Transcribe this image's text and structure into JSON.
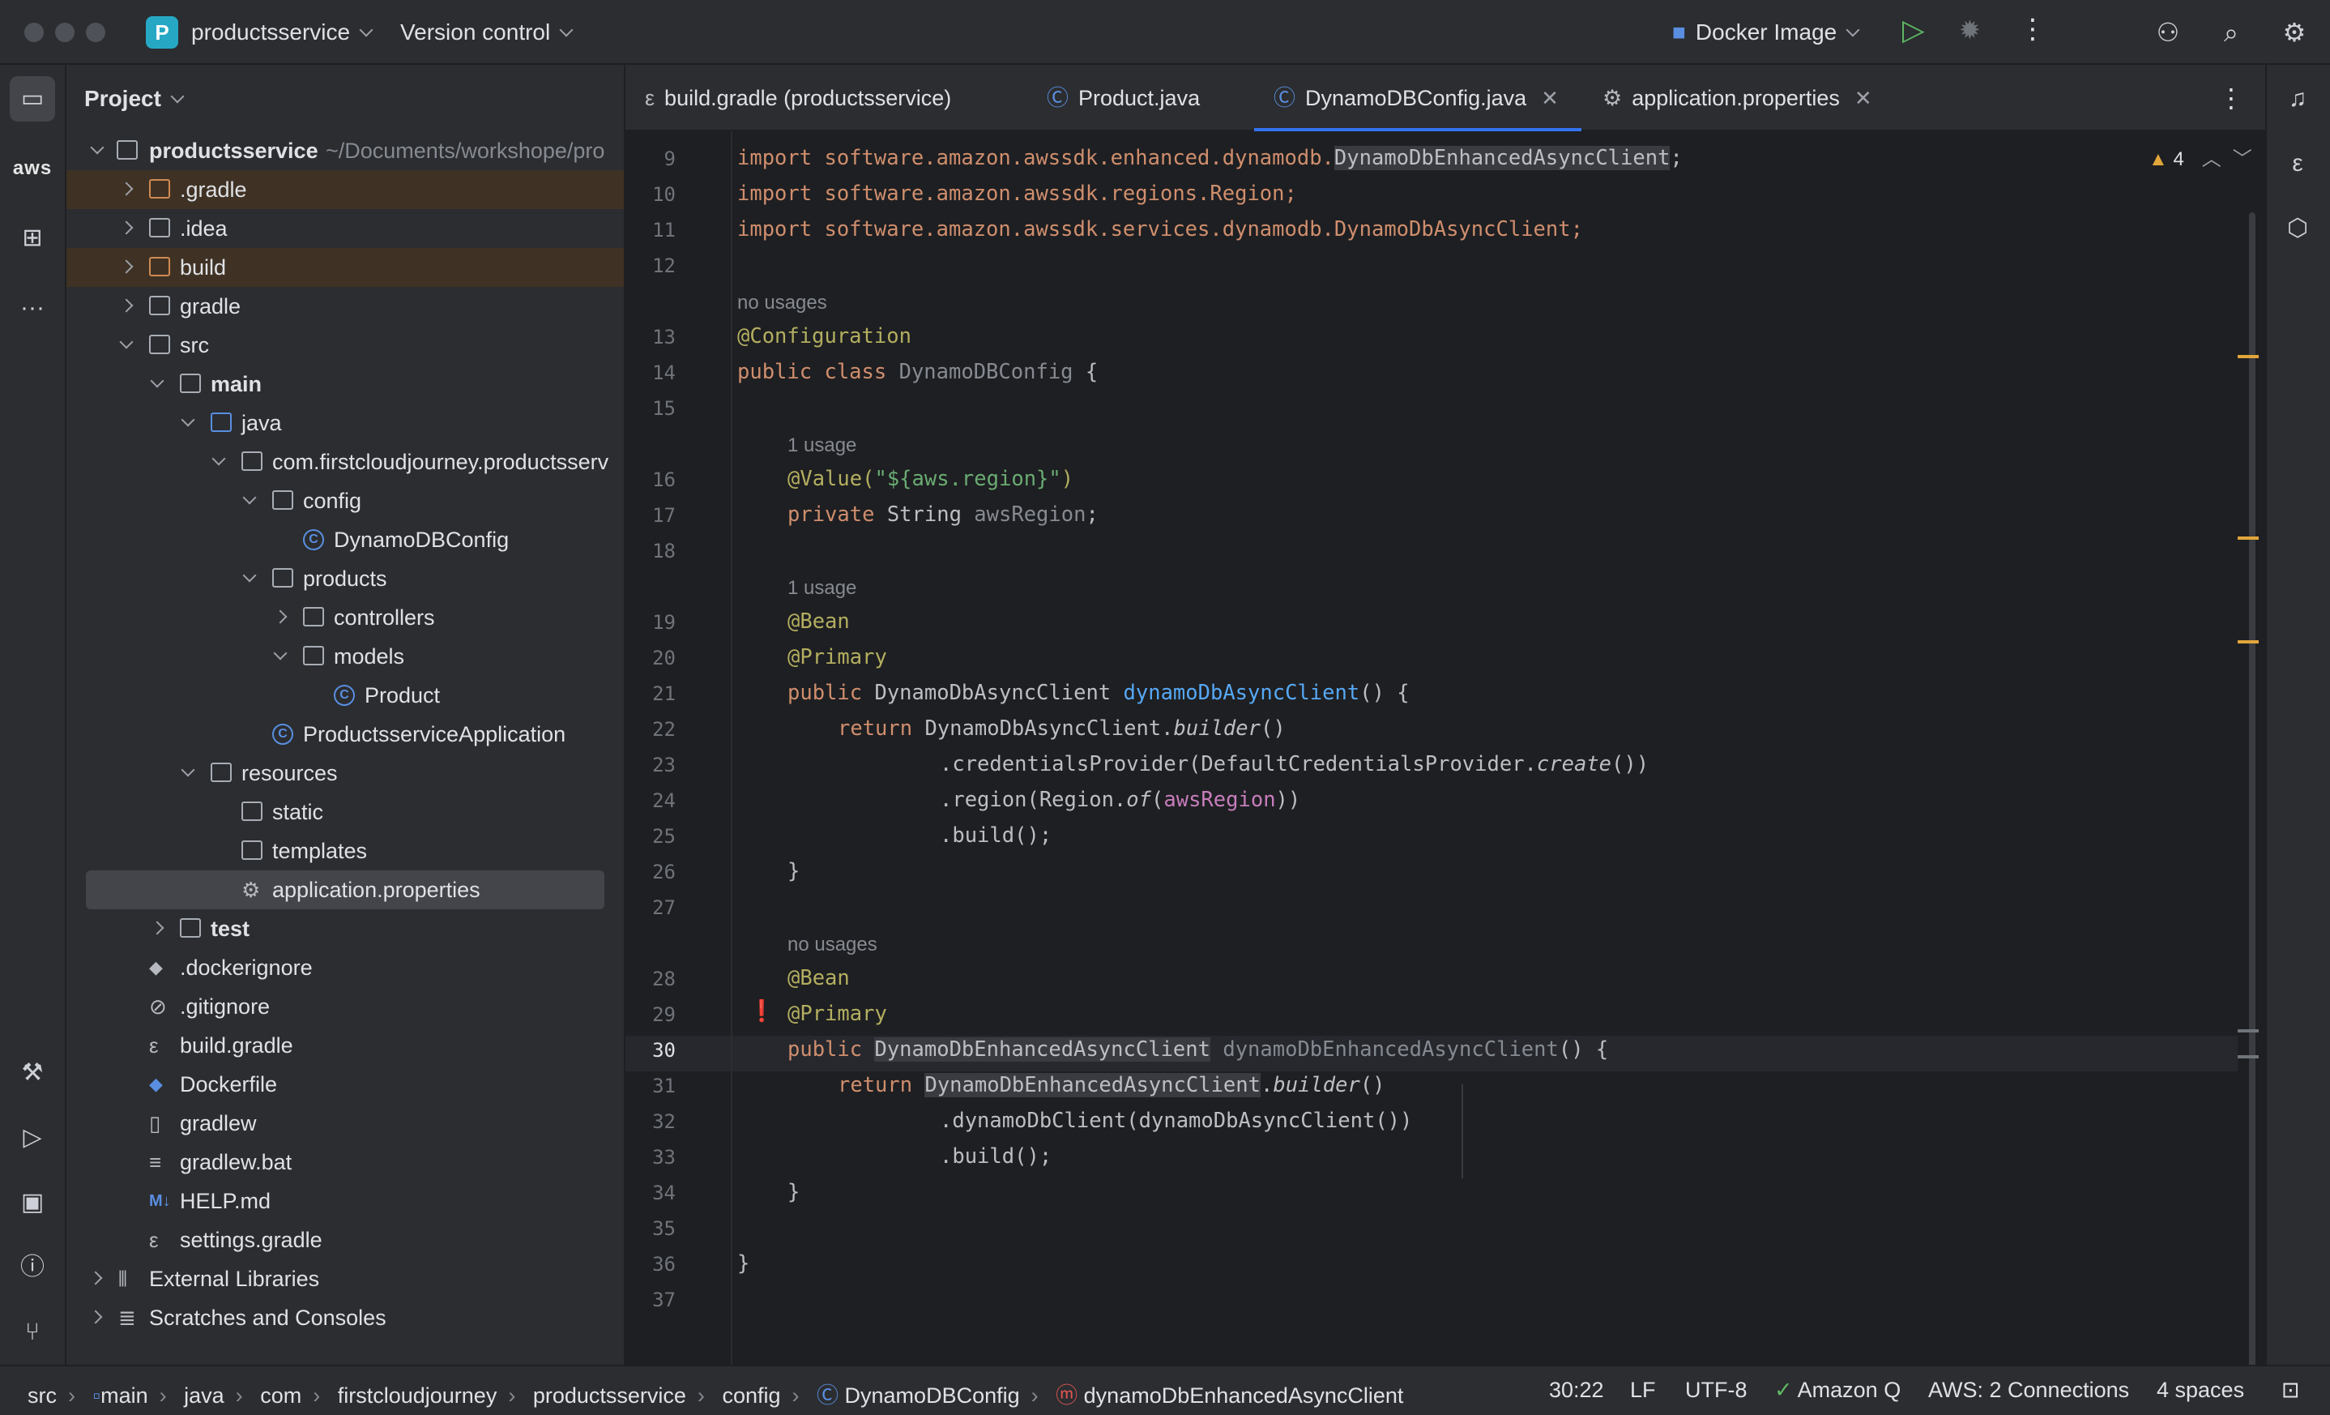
{
  "titlebar": {
    "project_badge": "P",
    "project_name": "productsservice",
    "vcs": "Version control",
    "run_config": "Docker Image"
  },
  "project_panel": {
    "title": "Project",
    "tree": [
      {
        "label": "productsservice",
        "path": "~/Documents/workshope/pro",
        "bold": true
      },
      {
        "label": ".gradle"
      },
      {
        "label": ".idea"
      },
      {
        "label": "build"
      },
      {
        "label": "gradle"
      },
      {
        "label": "src"
      },
      {
        "label": "main",
        "bold": true
      },
      {
        "label": "java"
      },
      {
        "label": "com.firstcloudjourney.productsserv"
      },
      {
        "label": "config"
      },
      {
        "label": "DynamoDBConfig"
      },
      {
        "label": "products"
      },
      {
        "label": "controllers"
      },
      {
        "label": "models"
      },
      {
        "label": "Product"
      },
      {
        "label": "ProductsserviceApplication"
      },
      {
        "label": "resources"
      },
      {
        "label": "static"
      },
      {
        "label": "templates"
      },
      {
        "label": "application.properties"
      },
      {
        "label": "test",
        "bold": true
      },
      {
        "label": ".dockerignore"
      },
      {
        "label": ".gitignore"
      },
      {
        "label": "build.gradle"
      },
      {
        "label": "Dockerfile"
      },
      {
        "label": "gradlew"
      },
      {
        "label": "gradlew.bat"
      },
      {
        "label": "HELP.md"
      },
      {
        "label": "settings.gradle"
      },
      {
        "label": "External Libraries"
      },
      {
        "label": "Scratches and Consoles"
      }
    ]
  },
  "tabs": [
    {
      "label": "build.gradle (productsservice)"
    },
    {
      "label": "Product.java"
    },
    {
      "label": "DynamoDBConfig.java",
      "active": true
    },
    {
      "label": "application.properties"
    }
  ],
  "editor": {
    "warnings_count": "4",
    "hints": {
      "no_usages": "no usages",
      "one_usage": "1 usage"
    },
    "line_numbers": [
      "9",
      "10",
      "11",
      "12",
      "13",
      "14",
      "15",
      "16",
      "17",
      "18",
      "19",
      "20",
      "21",
      "22",
      "23",
      "24",
      "25",
      "26",
      "27",
      "28",
      "29",
      "30",
      "31",
      "32",
      "33",
      "34",
      "35",
      "36",
      "37"
    ],
    "lines": {
      "l9a": "import software.amazon.awssdk.enhanced.dynamodb.",
      "l9b": "DynamoDbEnhancedAsyncClient",
      "l9c": ";",
      "l10": "import software.amazon.awssdk.regions.Region;",
      "l11": "import software.amazon.awssdk.services.dynamodb.DynamoDbAsyncClient;",
      "l13": "@Configuration",
      "l14a": "public class ",
      "l14b": "DynamoDBConfig",
      "l14c": " {",
      "l16a": "@Value(",
      "l16b": "\"${aws.region}\"",
      "l16c": ")",
      "l17a": "private ",
      "l17b": "String ",
      "l17c": "awsRegion",
      "l17d": ";",
      "l19": "@Bean",
      "l20": "@Primary",
      "l21a": "public ",
      "l21b": "DynamoDbAsyncClient ",
      "l21c": "dynamoDbAsyncClient",
      "l21d": "() {",
      "l22a": "return ",
      "l22b": "DynamoDbAsyncClient.",
      "l22c": "builder",
      "l22d": "()",
      "l23a": ".credentialsProvider(DefaultCredentialsProvider.",
      "l23b": "create",
      "l23c": "())",
      "l24a": ".region(Region.",
      "l24b": "of",
      "l24c": "(",
      "l24d": "awsRegion",
      "l24e": "))",
      "l25": ".build();",
      "l26": "}",
      "l28": "@Bean",
      "l29": "@Primary",
      "l30a": "public ",
      "l30b": "DynamoDbEnhancedAsyncClient",
      "l30c": " dynamoDbEnhancedAsyncClient",
      "l30d": "() {",
      "l31a": "return ",
      "l31b": "DynamoDbEnhancedAsyncClient",
      "l31c": ".",
      "l31d": "builder",
      "l31e": "()",
      "l32": ".dynamoDbClient(dynamoDbAsyncClient())",
      "l33": ".build();",
      "l34": "}",
      "l36": "}"
    }
  },
  "statusbar": {
    "breadcrumbs": [
      "src",
      "main",
      "java",
      "com",
      "firstcloudjourney",
      "productsservice",
      "config",
      "DynamoDBConfig",
      "dynamoDbEnhancedAsyncClient"
    ],
    "position": "30:22",
    "line_sep": "LF",
    "encoding": "UTF-8",
    "amazon_q": "Amazon Q",
    "aws": "AWS: 2 Connections",
    "indent": "4 spaces"
  },
  "colors": {
    "accent": "#3574f0",
    "keyword": "#cf8e6d",
    "annotation": "#b3ae60",
    "string": "#6aab73"
  }
}
